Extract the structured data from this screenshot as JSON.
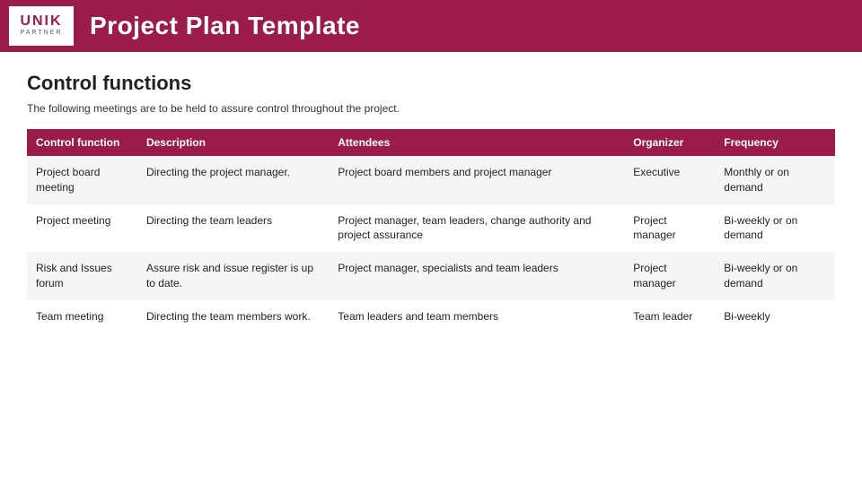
{
  "header": {
    "title": "Project Plan Template",
    "logo_top": "UNIK",
    "logo_bottom": "PARTNER"
  },
  "content": {
    "section_title": "Control functions",
    "intro": "The following meetings are to be held to assure control throughout the project.",
    "table": {
      "columns": [
        "Control function",
        "Description",
        "Attendees",
        "Organizer",
        "Frequency"
      ],
      "rows": [
        {
          "control_function": "Project board meeting",
          "description": "Directing the project manager.",
          "attendees": "Project board members and project manager",
          "organizer": "Executive",
          "frequency": "Monthly or on demand"
        },
        {
          "control_function": "Project meeting",
          "description": "Directing the team leaders",
          "attendees": "Project manager, team leaders, change authority and project assurance",
          "organizer": "Project manager",
          "frequency": "Bi-weekly or on demand"
        },
        {
          "control_function": "Risk and Issues forum",
          "description": "Assure risk and issue register is up to date.",
          "attendees": "Project manager, specialists and team leaders",
          "organizer": "Project manager",
          "frequency": "Bi-weekly or on demand"
        },
        {
          "control_function": "Team meeting",
          "description": "Directing the team members work.",
          "attendees": "Team leaders and team members",
          "organizer": "Team leader",
          "frequency": "Bi-weekly"
        }
      ]
    }
  }
}
